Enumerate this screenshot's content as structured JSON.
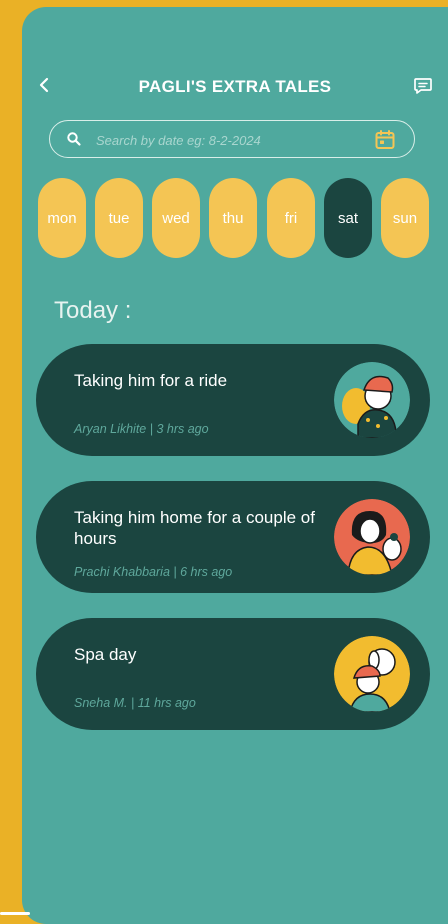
{
  "header": {
    "title": "PAGLI'S EXTRA TALES",
    "back_icon": "chevron-left-icon",
    "chat_icon": "chat-bubble-icon"
  },
  "search": {
    "placeholder": "Search by date eg: 8-2-2024",
    "value": "",
    "search_icon": "search-icon",
    "calendar_icon": "calendar-icon"
  },
  "days": [
    {
      "label": "mon",
      "selected": false
    },
    {
      "label": "tue",
      "selected": false
    },
    {
      "label": "wed",
      "selected": false
    },
    {
      "label": "thu",
      "selected": false
    },
    {
      "label": "fri",
      "selected": false
    },
    {
      "label": "sat",
      "selected": true
    },
    {
      "label": "sun",
      "selected": false
    }
  ],
  "section_title": "Today :",
  "tales": [
    {
      "title": "Taking him for a ride",
      "meta": "Aryan Likhite | 3 hrs ago",
      "avatar_bg": "#4fa99e"
    },
    {
      "title": "Taking him home for a couple of hours",
      "meta": "Prachi Khabbaria | 6 hrs ago",
      "avatar_bg": "#e8694f"
    },
    {
      "title": "Spa day",
      "meta": "Sneha M. | 11 hrs ago",
      "avatar_bg": "#f2bc2f"
    }
  ],
  "colors": {
    "background": "#eab126",
    "screen": "#4fa99e",
    "card": "#1b4540",
    "day_pill": "#f4c554",
    "day_active": "#1b4540"
  }
}
